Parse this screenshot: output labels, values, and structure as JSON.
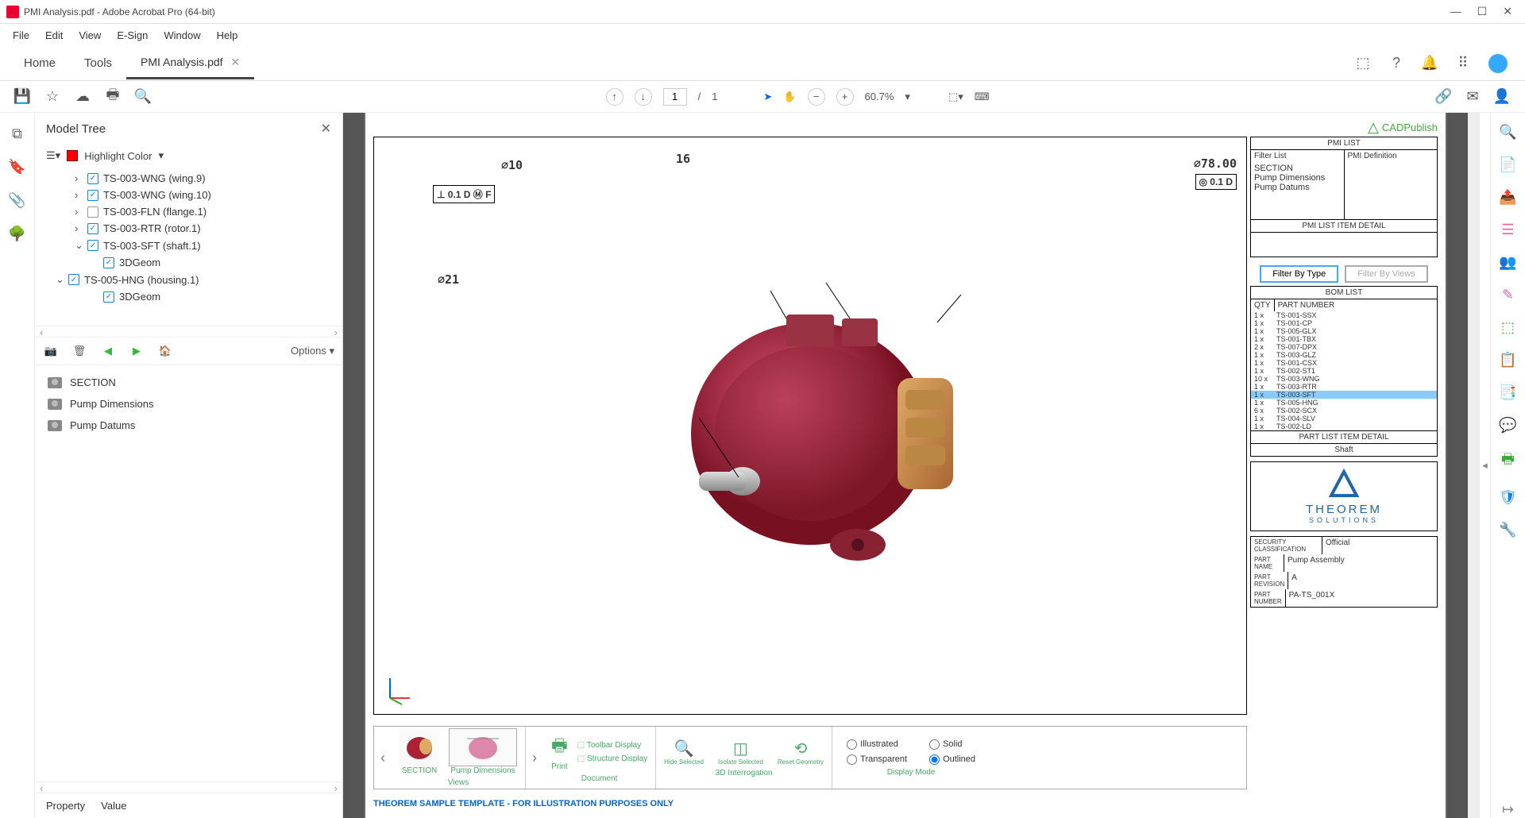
{
  "app": {
    "title": "PMI Analysis.pdf - Adobe Acrobat Pro (64-bit)"
  },
  "menu": {
    "file": "File",
    "edit": "Edit",
    "view": "View",
    "esign": "E-Sign",
    "window": "Window",
    "help": "Help"
  },
  "tabs": {
    "home": "Home",
    "tools": "Tools",
    "doc": "PMI Analysis.pdf"
  },
  "toolbar": {
    "page_current": "1",
    "page_sep": "/",
    "page_total": "1",
    "zoom": "60.7%"
  },
  "panel": {
    "title": "Model Tree",
    "highlight": "Highlight Color",
    "tree": [
      {
        "label": "TS-003-WNG (wing.9)",
        "checked": true,
        "chev": ">"
      },
      {
        "label": "TS-003-WNG (wing.10)",
        "checked": true,
        "chev": ">"
      },
      {
        "label": "TS-003-FLN (flange.1)",
        "checked": false,
        "chev": ">"
      },
      {
        "label": "TS-003-RTR (rotor.1)",
        "checked": true,
        "chev": ">"
      },
      {
        "label": "TS-003-SFT (shaft.1)",
        "checked": true,
        "chev": "v"
      },
      {
        "label": "3DGeom",
        "checked": true,
        "chev": "",
        "indent": 2
      },
      {
        "label": "TS-005-HNG (housing.1)",
        "checked": true,
        "chev": "v",
        "indent": 0
      },
      {
        "label": "3DGeom",
        "checked": true,
        "chev": "",
        "indent": 2
      }
    ],
    "options": "Options",
    "views": [
      {
        "label": "SECTION"
      },
      {
        "label": "Pump Dimensions"
      },
      {
        "label": "Pump Datums"
      }
    ],
    "property": "Property",
    "value": "Value"
  },
  "drawing": {
    "dims": {
      "d10": "⌀10",
      "d16": "16",
      "d78": "⌀78.00",
      "d21": "⌀21",
      "gdt1": "⊥ 0.1 D Ⓜ F",
      "gdt2": "◎ 0.1 D"
    },
    "footer": "THEOREM SAMPLE TEMPLATE - FOR ILLUSTRATION PURPOSES ONLY",
    "cadlogo": "CADPublish"
  },
  "rightpanel": {
    "pmi": {
      "hdr": "PMI LIST",
      "filter": "Filter List",
      "def": "PMI Definition",
      "items": [
        "SECTION",
        "Pump Dimensions",
        "Pump Datums"
      ],
      "detail": "PMI LIST ITEM DETAIL"
    },
    "filter_type": "Filter By Type",
    "filter_views": "Filter By Views",
    "bom": {
      "hdr": "BOM LIST",
      "qty": "QTY",
      "part": "PART NUMBER",
      "rows": [
        {
          "q": "1 x",
          "p": "TS-001-SSX"
        },
        {
          "q": "1 x",
          "p": "TS-001-CP"
        },
        {
          "q": "1 x",
          "p": "TS-005-GLX"
        },
        {
          "q": "1 x",
          "p": "TS-001-TBX"
        },
        {
          "q": "2 x",
          "p": "TS-007-DPX"
        },
        {
          "q": "1 x",
          "p": "TS-003-GLZ"
        },
        {
          "q": "1 x",
          "p": "TS-001-CSX"
        },
        {
          "q": "1 x",
          "p": "TS-002-ST1"
        },
        {
          "q": "10 x",
          "p": "TS-003-WNG"
        },
        {
          "q": "1 x",
          "p": "TS-003-RTR"
        },
        {
          "q": "1 x",
          "p": "TS-003-SFT",
          "sel": true
        },
        {
          "q": "1 x",
          "p": "TS-005-HNG"
        },
        {
          "q": "6 x",
          "p": "TS-002-SCX"
        },
        {
          "q": "1 x",
          "p": "TS-004-SLV"
        },
        {
          "q": "1 x",
          "p": "TS-002-LD"
        }
      ],
      "detail": "PART LIST ITEM DETAIL",
      "detailval": "Shaft"
    },
    "logo": "THEOREM",
    "logo2": "SOLUTIONS",
    "class": {
      "k": "SECURITY CLASSIFICATION",
      "v": "Official"
    },
    "partname": {
      "k": "PART NAME",
      "v": "Pump Assembly"
    },
    "partrev": {
      "k": "PART REVISION",
      "v": "A"
    },
    "partnum": {
      "k": "PART NUMBER",
      "v": "PA-TS_001X"
    }
  },
  "bottomtb": {
    "views": "Views",
    "section": "SECTION",
    "pumpdim": "Pump Dimensions",
    "print": "Print",
    "toolbar": "Toolbar Display",
    "structure": "Structure Display",
    "document": "Document",
    "hide": "Hide Selected",
    "isolate": "Isolate Selected",
    "reset": "Reset Geometry",
    "interrogation": "3D Interrogation",
    "illustrated": "Illustrated",
    "solid": "Solid",
    "transparent": "Transparent",
    "outlined": "Outlined",
    "displaymode": "Display Mode"
  }
}
